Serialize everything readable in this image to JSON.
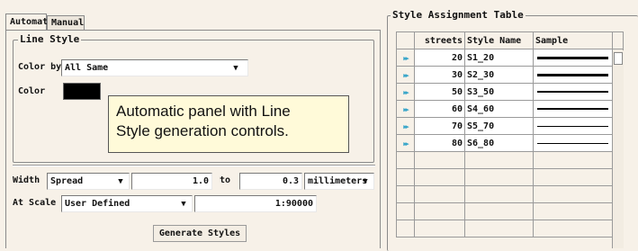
{
  "tabs": {
    "automatic": "Automatic",
    "manual": "Manual"
  },
  "line_style": {
    "legend": "Line Style",
    "color_by_label": "Color by",
    "color_by_value": "All Same",
    "color_label": "Color",
    "color_swatch": "#000000",
    "width_label": "Width",
    "width_mode": "Spread",
    "width_from": "1.0",
    "to_label": "to",
    "width_to": "0.3",
    "width_units": "millimeters",
    "at_scale_label": "At Scale",
    "scale_mode": "User Defined",
    "scale_value": "1:90000",
    "generate_button": "Generate Styles"
  },
  "callout": {
    "line1": "Automatic panel with Line",
    "line2": "Style generation controls."
  },
  "table": {
    "legend": "Style Assignment Table",
    "headers": {
      "streets": "streets",
      "style_name": "Style Name",
      "sample": "Sample"
    },
    "rows": [
      {
        "streets": "20",
        "style_name": "S1_20",
        "line_weight": 3
      },
      {
        "streets": "30",
        "style_name": "S2_30",
        "line_weight": 3
      },
      {
        "streets": "50",
        "style_name": "S3_50",
        "line_weight": 2
      },
      {
        "streets": "60",
        "style_name": "S4_60",
        "line_weight": 2
      },
      {
        "streets": "70",
        "style_name": "S5_70",
        "line_weight": 1
      },
      {
        "streets": "80",
        "style_name": "S6_80",
        "line_weight": 1
      }
    ],
    "row_icon": "play-arrow-icon"
  }
}
